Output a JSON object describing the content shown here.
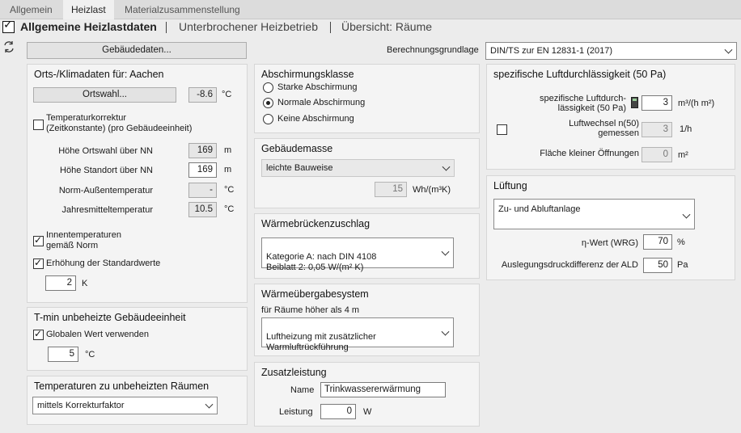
{
  "tabs": [
    "Allgemein",
    "Heizlast",
    "Materialzusammenstellung"
  ],
  "header": {
    "title": "Allgemeine Heizlastdaten",
    "link1": "Unterbrochener Heizbetrieb",
    "link2": "Übersicht: Räume"
  },
  "gebaeudedaten_button": "Gebäudedaten...",
  "berechnungsgrundlage": {
    "label": "Berechnungsgrundlage",
    "value": "DIN/TS zur EN 12831-1 (2017)"
  },
  "orts": {
    "title": "Orts-/Klimadaten für: Aachen",
    "ortswahl_button": "Ortswahl...",
    "temp_value": "-8.6",
    "temp_unit": "°C",
    "temperaturkorrektur": "Temperaturkorrektur\n(Zeitkonstante) (pro Gebäudeeinheit)",
    "rows": [
      {
        "label": "Höhe Ortswahl über NN",
        "value": "169",
        "unit": "m"
      },
      {
        "label": "Höhe Standort über NN",
        "value": "169",
        "unit": "m"
      },
      {
        "label": "Norm-Außentemperatur",
        "value": "-",
        "unit": "°C"
      },
      {
        "label": "Jahresmitteltemperatur",
        "value": "10.5",
        "unit": "°C"
      }
    ],
    "innentemp": "Innentemperaturen\ngemäß Norm",
    "erhoehung": "Erhöhung der Standardwerte",
    "erhoehung_value": "2",
    "erhoehung_unit": "K"
  },
  "tmin": {
    "title": "T-min unbeheizte Gebäudeeinheit",
    "global": "Globalen Wert verwenden",
    "value": "5",
    "unit": "°C"
  },
  "temp_unbeheizt": {
    "title": "Temperaturen zu unbeheizten Räumen",
    "value": "mittels Korrekturfaktor"
  },
  "abschirmung": {
    "title": "Abschirmungsklasse",
    "options": [
      "Starke Abschirmung",
      "Normale Abschirmung",
      "Keine Abschirmung"
    ],
    "selected_index": 1
  },
  "gebaeudemasse": {
    "title": "Gebäudemasse",
    "value": "leichte Bauweise",
    "field": "15",
    "unit": "Wh/(m³K)"
  },
  "waermebruecken": {
    "title": "Wärmebrückenzuschlag",
    "value": "Kategorie A: nach DIN 4108\nBeiblatt 2: 0,05 W/(m² K)"
  },
  "waermeuebergabe": {
    "title": "Wärmeübergabesystem",
    "subtitle": "für Räume höher als 4 m",
    "value": "Luftheizung mit zusätzlicher\nWarmluftrückführung"
  },
  "zusatz": {
    "title": "Zusatzleistung",
    "name_label": "Name",
    "name_value": "Trinkwassererwärmung",
    "leistung_label": "Leistung",
    "leistung_value": "0",
    "leistung_unit": "W"
  },
  "luftdurch": {
    "title": "spezifische Luftdurchlässigkeit (50 Pa)",
    "spez_label": "spezifische Luftdurch-\nlässigkeit (50 Pa)",
    "spez_value": "3",
    "spez_unit": "m³/(h m²)",
    "luftwechsel_label": "Luftwechsel n(50)\ngemessen",
    "luftwechsel_value": "3",
    "luftwechsel_unit": "1/h",
    "flaeche_label": "Fläche kleiner Öffnungen",
    "flaeche_value": "0",
    "flaeche_unit": "m²"
  },
  "lueftung": {
    "title": "Lüftung",
    "value": "Zu- und Abluftanlage",
    "eta_label": "η-Wert (WRG)",
    "eta_value": "70",
    "eta_unit": "%",
    "ald_label": "Auslegungsdruckdifferenz der ALD",
    "ald_value": "50",
    "ald_unit": "Pa"
  }
}
